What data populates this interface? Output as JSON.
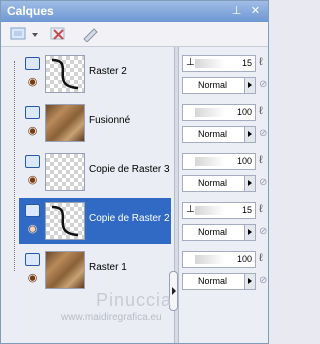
{
  "window": {
    "title": "Calques",
    "pin_glyph": "⊥",
    "close_glyph": "✕"
  },
  "toolbar": {
    "icons": [
      "new-layer-icon",
      "dropdown-arrow-icon",
      "delete-layer-icon",
      "edit-icon"
    ]
  },
  "layers": [
    {
      "name": "Raster 2",
      "opacity": "15",
      "blend": "Normal",
      "thumb": "stroke",
      "selected": false
    },
    {
      "name": "Fusionné",
      "opacity": "100",
      "blend": "Normal",
      "thumb": "photo",
      "selected": false
    },
    {
      "name": "Copie de Raster 3",
      "opacity": "100",
      "blend": "Normal",
      "thumb": "empty",
      "selected": false
    },
    {
      "name": "Copie de Raster 2",
      "opacity": "15",
      "blend": "Normal",
      "thumb": "stroke",
      "selected": true
    },
    {
      "name": "Raster 1",
      "opacity": "100",
      "blend": "Normal",
      "thumb": "photo",
      "selected": false
    }
  ],
  "watermark": {
    "name": "Pinuccia",
    "site": "www.maidiregrafica.eu"
  }
}
